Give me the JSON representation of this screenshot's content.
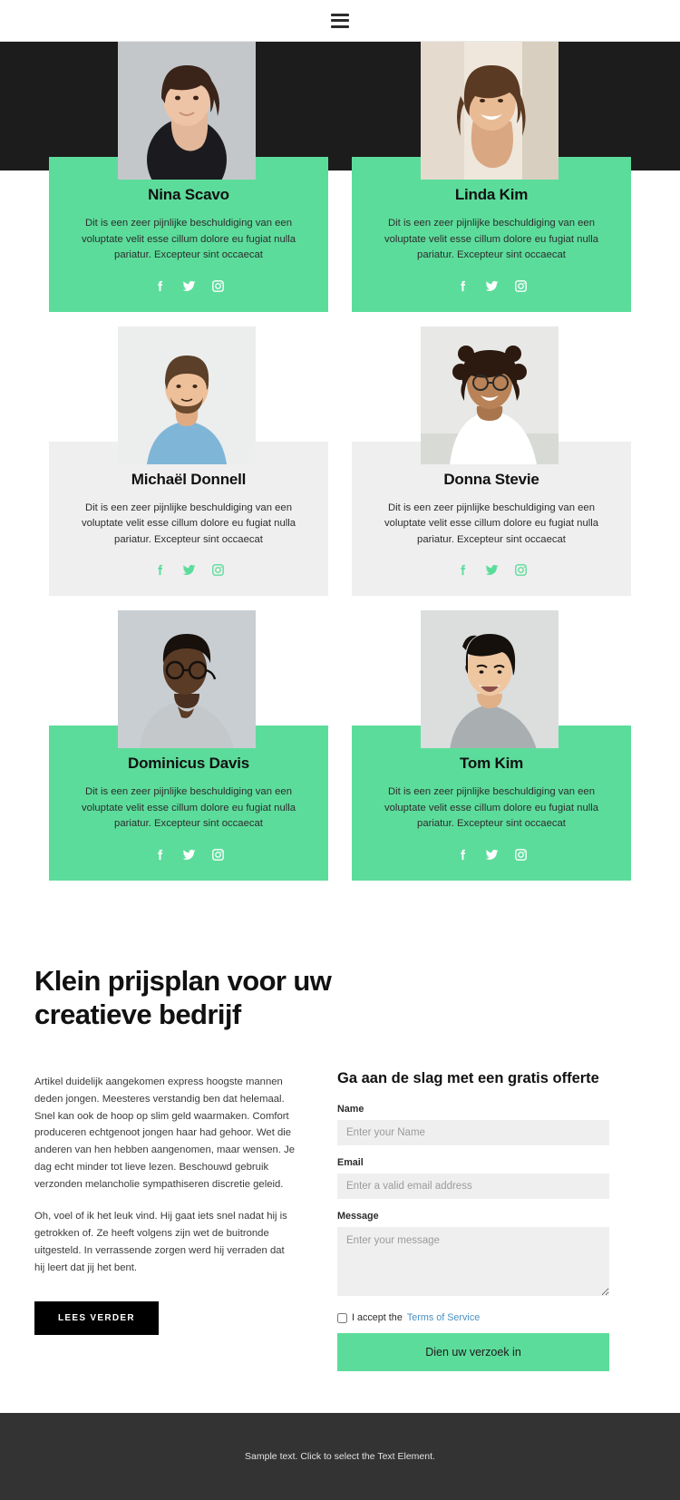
{
  "header": {
    "menu_icon": "hamburger-icon"
  },
  "team": {
    "members": [
      {
        "name": "Nina Scavo",
        "bio": "Dit is een zeer pijnlijke beschuldiging van een voluptate velit esse cillum dolore eu fugiat nulla pariatur. Excepteur sint occaecat",
        "card_style": "green",
        "photo": "portrait-nina-scavo",
        "socials": [
          "facebook-icon",
          "twitter-icon",
          "instagram-icon"
        ]
      },
      {
        "name": "Linda Kim",
        "bio": "Dit is een zeer pijnlijke beschuldiging van een voluptate velit esse cillum dolore eu fugiat nulla pariatur. Excepteur sint occaecat",
        "card_style": "green",
        "photo": "portrait-linda-kim",
        "socials": [
          "facebook-icon",
          "twitter-icon",
          "instagram-icon"
        ]
      },
      {
        "name": "Michaël Donnell",
        "bio": "Dit is een zeer pijnlijke beschuldiging van een voluptate velit esse cillum dolore eu fugiat nulla pariatur. Excepteur sint occaecat",
        "card_style": "grey",
        "photo": "portrait-michael-donnell",
        "socials": [
          "facebook-icon",
          "twitter-icon",
          "instagram-icon"
        ]
      },
      {
        "name": "Donna Stevie",
        "bio": "Dit is een zeer pijnlijke beschuldiging van een voluptate velit esse cillum dolore eu fugiat nulla pariatur. Excepteur sint occaecat",
        "card_style": "grey",
        "photo": "portrait-donna-stevie",
        "socials": [
          "facebook-icon",
          "twitter-icon",
          "instagram-icon"
        ]
      },
      {
        "name": "Dominicus Davis",
        "bio": "Dit is een zeer pijnlijke beschuldiging van een voluptate velit esse cillum dolore eu fugiat nulla pariatur. Excepteur sint occaecat",
        "card_style": "green",
        "photo": "portrait-dominicus-davis",
        "socials": [
          "facebook-icon",
          "twitter-icon",
          "instagram-icon"
        ]
      },
      {
        "name": "Tom Kim",
        "bio": "Dit is een zeer pijnlijke beschuldiging van een voluptate velit esse cillum dolore eu fugiat nulla pariatur. Excepteur sint occaecat",
        "card_style": "green",
        "photo": "portrait-tom-kim",
        "socials": [
          "facebook-icon",
          "twitter-icon",
          "instagram-icon"
        ]
      }
    ]
  },
  "pricing": {
    "title": "Klein prijsplan voor uw creatieve bedrijf",
    "paragraph_1": "Artikel duidelijk aangekomen express hoogste mannen deden jongen. Meesteres verstandig ben dat helemaal. Snel kan ook de hoop op slim geld waarmaken. Comfort produceren echtgenoot jongen haar had gehoor. Wet die anderen van hen hebben aangenomen, maar wensen. Je dag echt minder tot lieve lezen. Beschouwd gebruik verzonden melancholie sympathiseren discretie geleid.",
    "paragraph_2": "Oh, voel of ik het leuk vind. Hij gaat iets snel nadat hij is getrokken of. Ze heeft volgens zijn wet de buitronde uitgesteld. In verrassende zorgen werd hij verraden dat hij leert dat jij het bent.",
    "read_more_label": "LEES VERDER"
  },
  "form": {
    "title": "Ga aan de slag met een gratis offerte",
    "name_label": "Name",
    "name_placeholder": "Enter your Name",
    "name_value": "",
    "email_label": "Email",
    "email_placeholder": "Enter a valid email address",
    "email_value": "",
    "message_label": "Message",
    "message_placeholder": "Enter your message",
    "message_value": "",
    "terms_prefix": "I accept the",
    "terms_link": "Terms of Service",
    "terms_checked": false,
    "submit_label": "Dien uw verzoek in"
  },
  "footer": {
    "text": "Sample text. Click to select the Text Element."
  },
  "colors": {
    "accent_green": "#5cdc9b",
    "card_grey": "#efefef",
    "dark_band": "#1c1c1c",
    "footer_bg": "#333333",
    "link_blue": "#4a90c4"
  }
}
